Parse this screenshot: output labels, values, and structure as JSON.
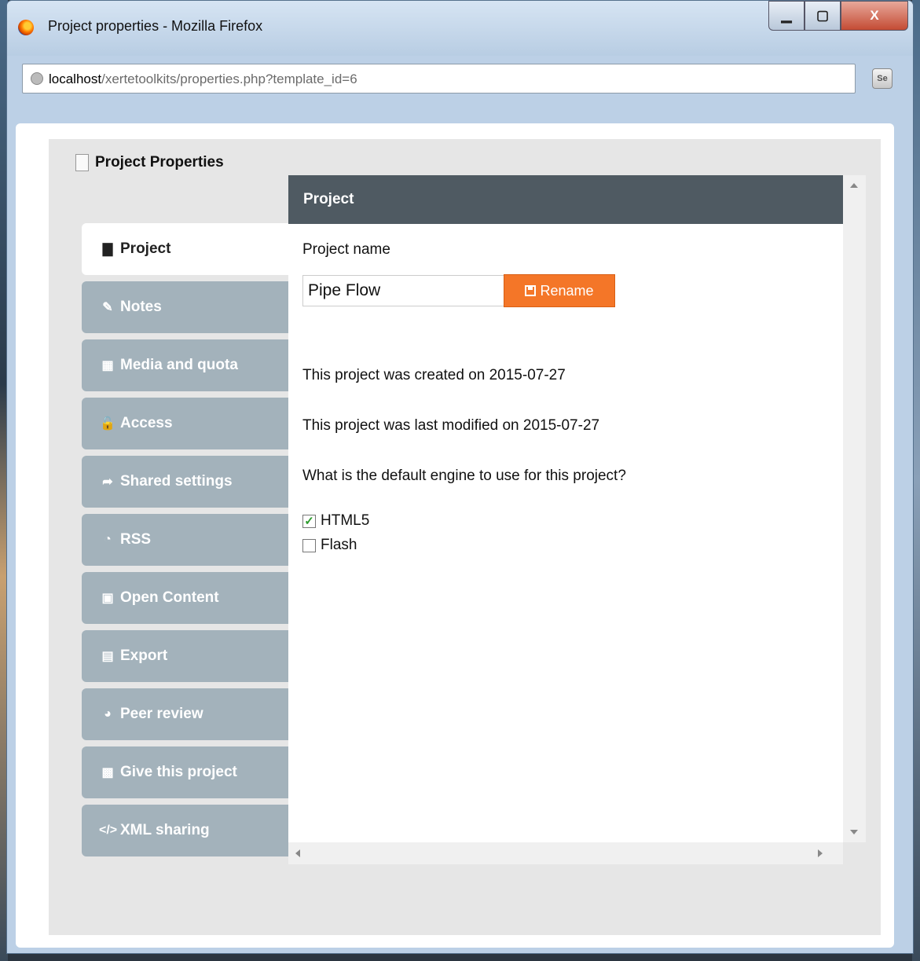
{
  "window": {
    "title": "Project properties - Mozilla Firefox",
    "minimize": "▁",
    "maximize": "▢",
    "close": "X"
  },
  "urlbar": {
    "host": "localhost",
    "path": "/xertetoolkits/properties.php?template_id=6",
    "se_label": "Se"
  },
  "panel": {
    "title": "Project Properties"
  },
  "tabs": [
    {
      "label": "Project",
      "icon": "file-icon",
      "glyph": "▇"
    },
    {
      "label": "Notes",
      "icon": "edit-icon",
      "glyph": "✎"
    },
    {
      "label": "Media and quota",
      "icon": "film-icon",
      "glyph": "▦"
    },
    {
      "label": "Access",
      "icon": "unlock-icon",
      "glyph": "🔓"
    },
    {
      "label": "Shared settings",
      "icon": "share-icon",
      "glyph": "➦"
    },
    {
      "label": "RSS",
      "icon": "rss-icon",
      "glyph": "◔"
    },
    {
      "label": "Open Content",
      "icon": "cc-icon",
      "glyph": "▣"
    },
    {
      "label": "Export",
      "icon": "save-icon",
      "glyph": "▤"
    },
    {
      "label": "Peer review",
      "icon": "comments-icon",
      "glyph": "◕"
    },
    {
      "label": "Give this project",
      "icon": "gift-icon",
      "glyph": "▩"
    },
    {
      "label": "XML sharing",
      "icon": "code-icon",
      "glyph": "</>"
    }
  ],
  "main": {
    "header": "Project",
    "name_label": "Project name",
    "name_value": "Pipe Flow",
    "rename_label": "Rename",
    "created": "This project was created on 2015-07-27",
    "modified": "This project was last modified on 2015-07-27",
    "engine_question": "What is the default engine to use for this project?",
    "engines": [
      {
        "label": "HTML5",
        "checked": true
      },
      {
        "label": "Flash",
        "checked": false
      }
    ]
  },
  "colors": {
    "accent": "#f47628",
    "header": "#4f5a62",
    "tab": "#a3b2bb"
  }
}
